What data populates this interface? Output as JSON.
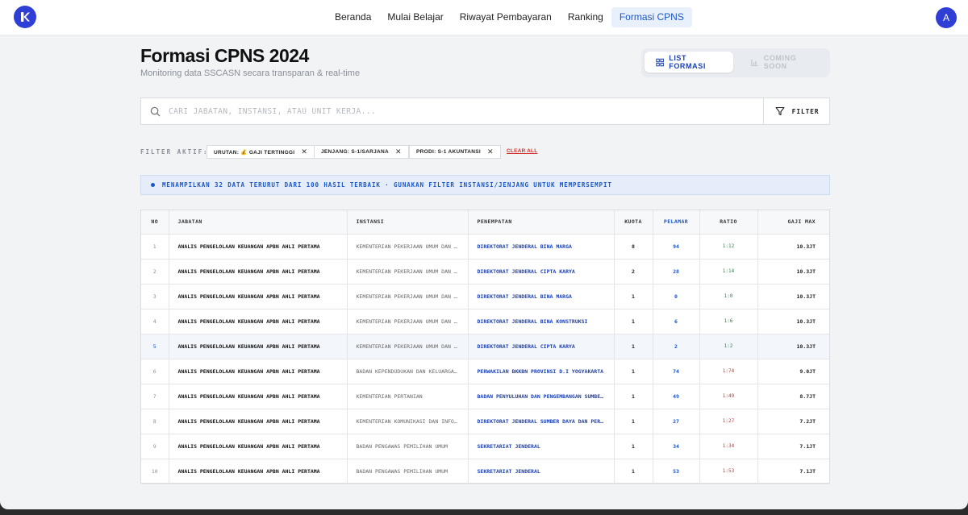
{
  "nav": {
    "links": [
      "Beranda",
      "Mulai Belajar",
      "Riwayat Pembayaran",
      "Ranking",
      "Formasi CPNS"
    ],
    "active": "Formasi CPNS",
    "avatar_initial": "A"
  },
  "header": {
    "title": "Formasi CPNS 2024",
    "subtitle": "Monitoring data SSCASN secara transparan & real-time",
    "toggle_list": "LIST FORMASI",
    "toggle_soon": "COMING SOON"
  },
  "search": {
    "placeholder": "CARI JABATAN, INSTANSI, ATAU UNIT KERJA...",
    "filter_label": "FILTER"
  },
  "filters": {
    "label": "FILTER AKTIF:",
    "chips": [
      "URUTAN: 💰 GAJI TERTINGGI",
      "JENJANG: S-1/SARJANA",
      "PRODI: S-1 AKUNTANSI"
    ],
    "clear_all": "CLEAR ALL"
  },
  "info": {
    "text": "MENAMPILKAN 32 DATA TERURUT DARI 100 HASIL TERBAIK · GUNAKAN FILTER INSTANSI/JENJANG UNTUK MEMPERSEMPIT"
  },
  "table": {
    "columns": [
      "NO",
      "JABATAN",
      "INSTANSI",
      "PENEMPATAN",
      "KUOTA",
      "PELAMAR",
      "RATIO",
      "GAJI MAX"
    ],
    "rows": [
      {
        "no": "1",
        "jabatan": "ANALIS PENGELOLAAN KEUANGAN APBN AHLI PERTAMA",
        "instansi": "KEMENTERIAN PEKERJAAN UMUM DAN PERUMAHAN RAKYAT",
        "penempatan": "DIREKTORAT JENDERAL BINA MARGA",
        "kuota": "8",
        "pelamar": "94",
        "ratio": "1:12",
        "ratio_status": "green",
        "gaji": "10.3JT"
      },
      {
        "no": "2",
        "jabatan": "ANALIS PENGELOLAAN KEUANGAN APBN AHLI PERTAMA",
        "instansi": "KEMENTERIAN PEKERJAAN UMUM DAN PERUMAHAN RAKYAT",
        "penempatan": "DIREKTORAT JENDERAL CIPTA KARYA",
        "kuota": "2",
        "pelamar": "28",
        "ratio": "1:14",
        "ratio_status": "green",
        "gaji": "10.3JT"
      },
      {
        "no": "3",
        "jabatan": "ANALIS PENGELOLAAN KEUANGAN APBN AHLI PERTAMA",
        "instansi": "KEMENTERIAN PEKERJAAN UMUM DAN PERUMAHAN RAKYAT",
        "penempatan": "DIREKTORAT JENDERAL BINA MARGA",
        "kuota": "1",
        "pelamar": "0",
        "ratio": "1:0",
        "ratio_status": "green",
        "gaji": "10.3JT"
      },
      {
        "no": "4",
        "jabatan": "ANALIS PENGELOLAAN KEUANGAN APBN AHLI PERTAMA",
        "instansi": "KEMENTERIAN PEKERJAAN UMUM DAN PERUMAHAN RAKYAT",
        "penempatan": "DIREKTORAT JENDERAL BINA KONSTRUKSI",
        "kuota": "1",
        "pelamar": "6",
        "ratio": "1:6",
        "ratio_status": "green",
        "gaji": "10.3JT"
      },
      {
        "no": "5",
        "jabatan": "ANALIS PENGELOLAAN KEUANGAN APBN AHLI PERTAMA",
        "instansi": "KEMENTERIAN PEKERJAAN UMUM DAN PERUMAHAN RAKYAT",
        "penempatan": "DIREKTORAT JENDERAL CIPTA KARYA",
        "kuota": "1",
        "pelamar": "2",
        "ratio": "1:2",
        "ratio_status": "green",
        "gaji": "10.3JT"
      },
      {
        "no": "6",
        "jabatan": "ANALIS PENGELOLAAN KEUANGAN APBN AHLI PERTAMA",
        "instansi": "BADAN KEPENDUDUKAN DAN KELUARGA BERENCANA NASIONAL",
        "penempatan": "PERWAKILAN BKKBN PROVINSI D.I YOGYAKARTA",
        "kuota": "1",
        "pelamar": "74",
        "ratio": "1:74",
        "ratio_status": "red",
        "gaji": "9.0JT"
      },
      {
        "no": "7",
        "jabatan": "ANALIS PENGELOLAAN KEUANGAN APBN AHLI PERTAMA",
        "instansi": "KEMENTERIAN PERTANIAN",
        "penempatan": "BADAN PENYULUHAN DAN PENGEMBANGAN SUMBER DAYA MANUSIA PERTANIAN",
        "kuota": "1",
        "pelamar": "49",
        "ratio": "1:49",
        "ratio_status": "red",
        "gaji": "8.7JT"
      },
      {
        "no": "8",
        "jabatan": "ANALIS PENGELOLAAN KEUANGAN APBN AHLI PERTAMA",
        "instansi": "KEMENTERIAN KOMUNIKASI DAN INFORMATIKA",
        "penempatan": "DIREKTORAT JENDERAL SUMBER DAYA DAN PERANGKAT POS",
        "kuota": "1",
        "pelamar": "27",
        "ratio": "1:27",
        "ratio_status": "red",
        "gaji": "7.2JT"
      },
      {
        "no": "9",
        "jabatan": "ANALIS PENGELOLAAN KEUANGAN APBN AHLI PERTAMA",
        "instansi": "BADAN PENGAWAS PEMILIHAN UMUM",
        "penempatan": "SEKRETARIAT JENDERAL",
        "kuota": "1",
        "pelamar": "34",
        "ratio": "1:34",
        "ratio_status": "red",
        "gaji": "7.1JT"
      },
      {
        "no": "10",
        "jabatan": "ANALIS PENGELOLAAN KEUANGAN APBN AHLI PERTAMA",
        "instansi": "BADAN PENGAWAS PEMILIHAN UMUM",
        "penempatan": "SEKRETARIAT JENDERAL",
        "kuota": "1",
        "pelamar": "53",
        "ratio": "1:53",
        "ratio_status": "red",
        "gaji": "7.1JT"
      }
    ],
    "highlighted_row": 5
  }
}
